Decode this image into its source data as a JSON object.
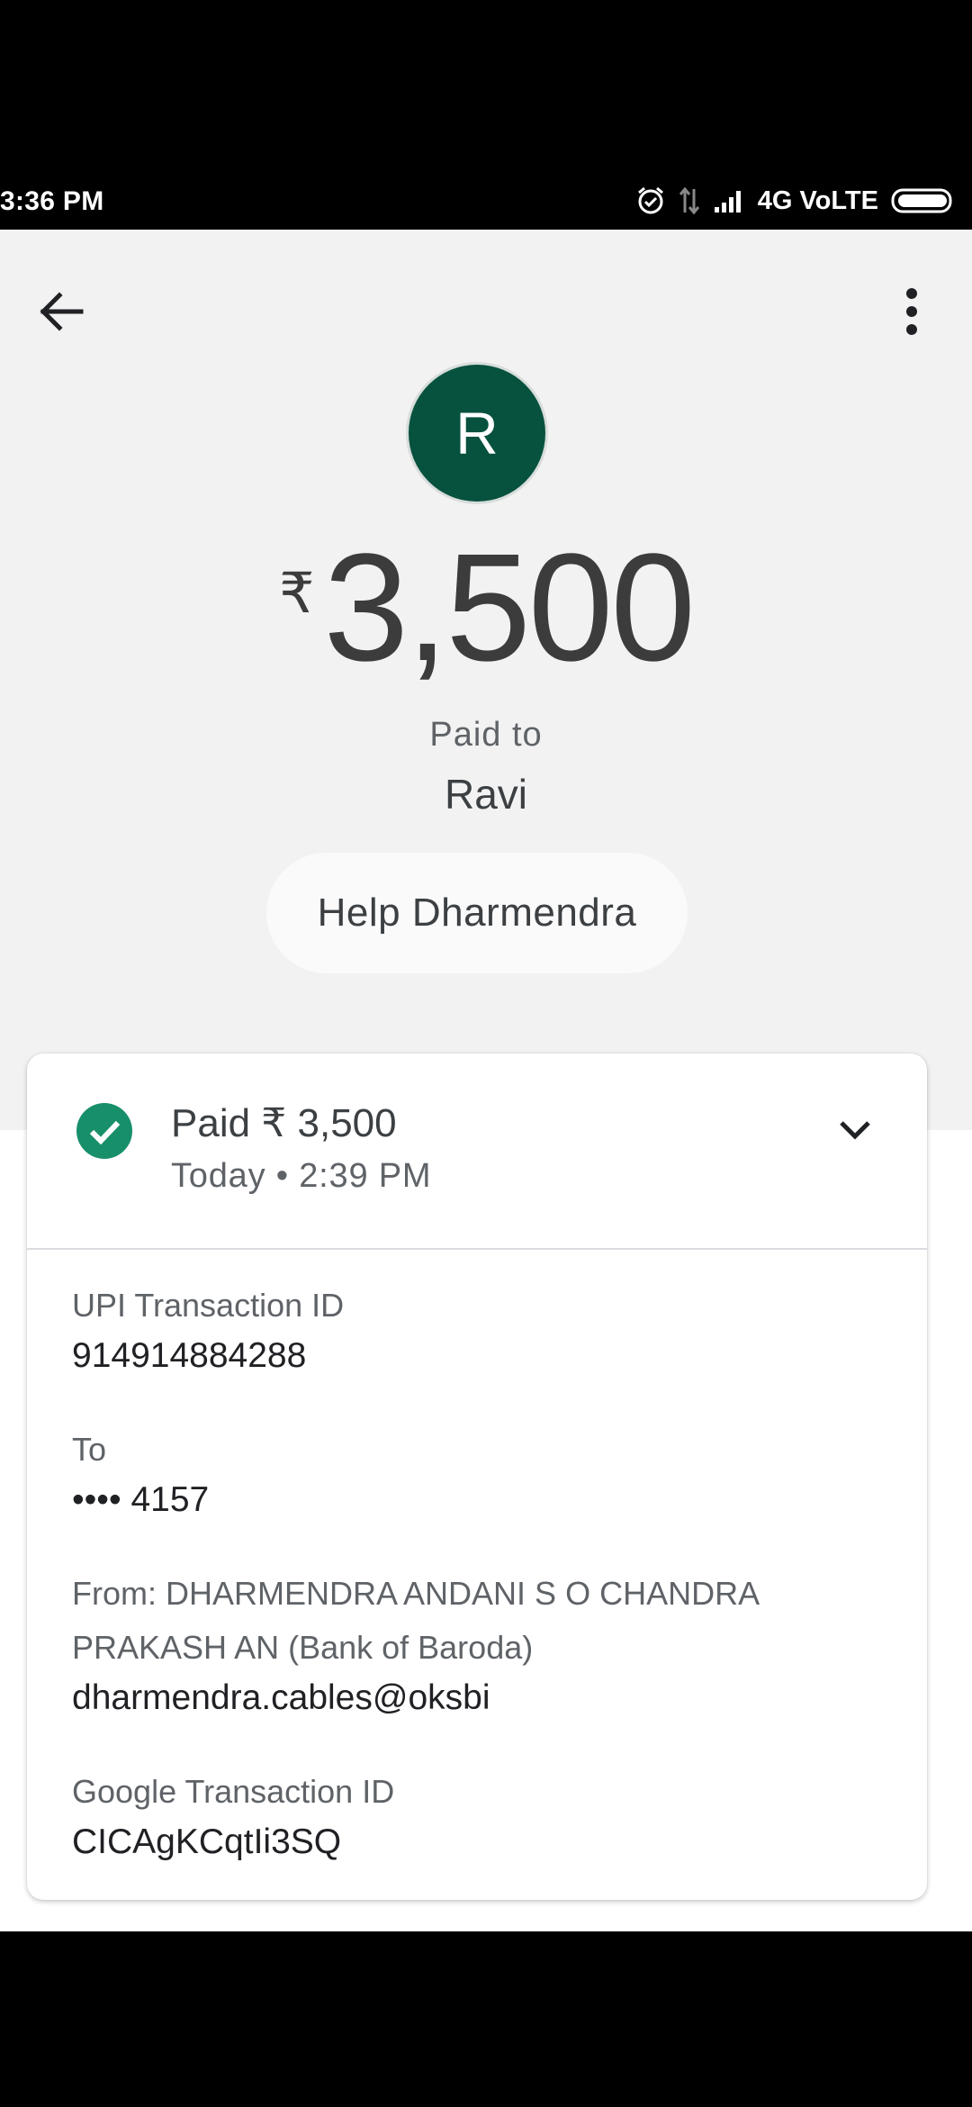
{
  "status_bar": {
    "time": "3:36 PM",
    "network": "4G VoLTE"
  },
  "header": {
    "avatar_letter": "R",
    "currency_symbol": "₹",
    "amount": "3,500",
    "paid_to_label": "Paid to",
    "payee_name": "Ravi",
    "help_button_label": "Help Dharmendra"
  },
  "transaction": {
    "status_text": "Paid ₹ 3,500",
    "date_time": "Today • 2:39 PM",
    "upi_id_label": "UPI Transaction ID",
    "upi_id": "914914884288",
    "to_label": "To",
    "to_account": "•••• 4157",
    "from_label_line1": "From: DHARMENDRA ANDANI S O CHANDRA",
    "from_label_line2": "PRAKASH AN (Bank of Baroda)",
    "from_upi": "dharmendra.cables@oksbi",
    "google_id_label": "Google Transaction ID",
    "google_id": "CICAgKCqtIi3SQ"
  },
  "icons": {
    "back": "arrow-back-icon",
    "more": "more-vert-icon",
    "status": "check-circle-icon",
    "expand": "chevron-down-icon"
  },
  "colors": {
    "avatar_bg": "#07513f",
    "success_green": "#188f6b",
    "header_bg": "#f2f2f2"
  }
}
